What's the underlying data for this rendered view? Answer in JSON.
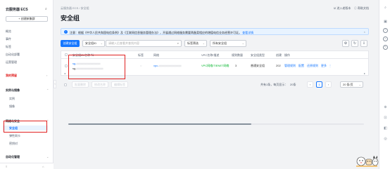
{
  "sidebar": {
    "title": "云服务器 ECS",
    "new_button": "+ 创建新集群",
    "items_top": [
      "概览",
      "事件",
      "标签",
      "自动化部署",
      "运营管理"
    ],
    "group_instances": "实例与镜像",
    "instance_items": [
      "实例",
      "镜像"
    ],
    "group_network": "网络与安全",
    "network_items": [
      "安全组",
      "弹性网卡",
      "密钥对"
    ],
    "group_auto": "自动化管理",
    "bottom_left": "≡",
    "bottom_right": "⌂"
  },
  "header": {
    "breadcrumb": "云服务器 ECS  /  安全组",
    "title": "安全组",
    "link_old": "☑ 进入老版本",
    "link_help": "ⓘ 帮助文档"
  },
  "notice": {
    "icon": "i",
    "text": "注意：根据《中华人民共和国电信条例》及《互联网信息服务管理办法》，开展通过网络服务需要两备案相应的增值电信业务经营许可证。",
    "link": "查看详情",
    "close": "×"
  },
  "toolbar": {
    "create_button": "创建安全组",
    "filter_select": "安全组ID",
    "search_placeholder": "请输入后查看并查找内容",
    "tag_filter": "标签筛选",
    "group_type": "所有安全组",
    "icons": [
      "⚙",
      "↻",
      "⇩"
    ]
  },
  "table": {
    "headers": [
      "安全组ID/名称 ⇅",
      "标签",
      "网络",
      "VPC名称/描述",
      "规则数量",
      "安全组类型",
      "创建",
      "操作"
    ],
    "rows": [
      {
        "id": "sg-",
        "name": "sg-",
        "tag": "◌",
        "network": "vpc-",
        "vpc": "VPC网络/TIENET网络",
        "rules": "3",
        "type": "普通安全组",
        "created": "202",
        "actions": [
          "管理规则",
          "配置",
          "还原规则",
          "更多"
        ]
      }
    ]
  },
  "footer": {
    "batch_buttons": [
      "批量删除",
      "修改名称",
      "编辑标签"
    ],
    "total": "共有1条，每页显示：",
    "page_size": "20条",
    "current_page": "1",
    "page_select": "20 条/页"
  },
  "rail": {
    "icons": [
      "⌕",
      "▣",
      "?",
      "⌗",
      "✎",
      "⊕",
      "⊡",
      "◧",
      "◎"
    ]
  }
}
